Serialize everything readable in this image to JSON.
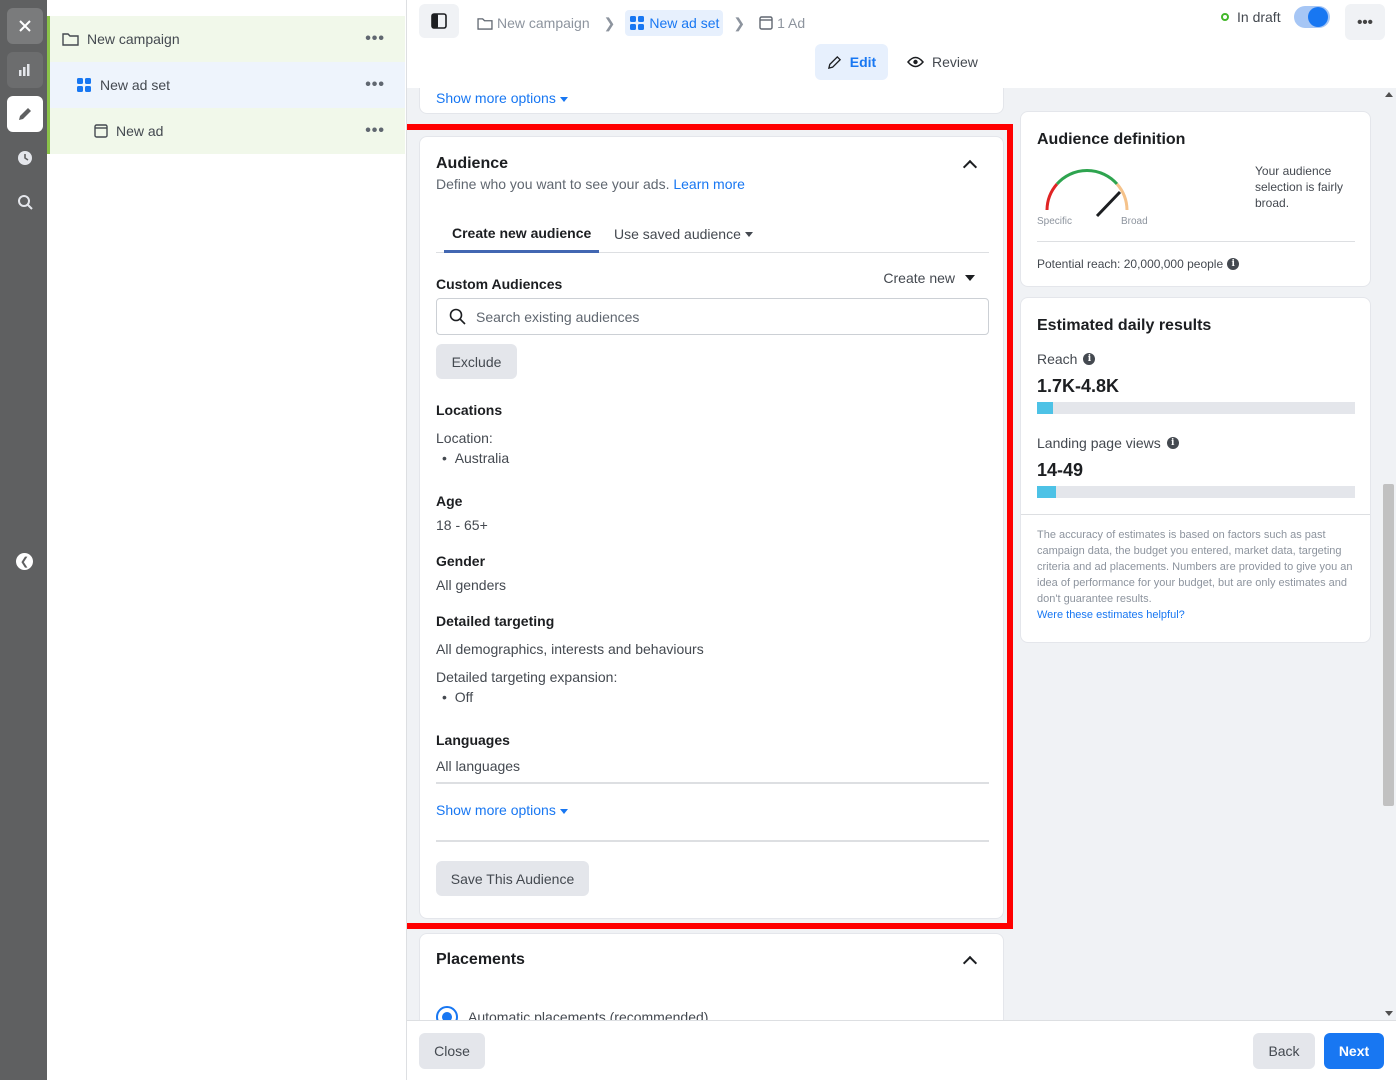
{
  "tree": {
    "campaign": "New campaign",
    "ad_set": "New ad set",
    "ad": "New ad",
    "more": "•••"
  },
  "header": {
    "breadcrumbs": [
      "New campaign",
      "New ad set",
      "1 Ad"
    ],
    "status": "In draft",
    "more": "•••",
    "edit_tab": "Edit",
    "review_tab": "Review"
  },
  "top_card": {
    "show_more": "Show more options"
  },
  "audience": {
    "title": "Audience",
    "subtitle": "Define who you want to see your ads.",
    "learn_more": "Learn more",
    "tab_create": "Create new audience",
    "tab_saved": "Use saved audience",
    "custom_label": "Custom Audiences",
    "create_new": "Create new",
    "search_placeholder": "Search existing audiences",
    "exclude": "Exclude",
    "locations_label": "Locations",
    "location_caption": "Location:",
    "location_value": "Australia",
    "age_label": "Age",
    "age_value": "18 - 65+",
    "gender_label": "Gender",
    "gender_value": "All genders",
    "targeting_label": "Detailed targeting",
    "targeting_value": "All demographics, interests and behaviours",
    "expansion_caption": "Detailed targeting expansion:",
    "expansion_value": "Off",
    "languages_label": "Languages",
    "languages_value": "All languages",
    "show_more": "Show more options",
    "save": "Save This Audience"
  },
  "placements": {
    "title": "Placements",
    "option": "Automatic placements (recommended)"
  },
  "definition": {
    "title": "Audience definition",
    "specific": "Specific",
    "broad": "Broad",
    "description": "Your audience selection is fairly broad.",
    "potential_reach": "Potential reach: 20,000,000 people"
  },
  "estimates": {
    "title": "Estimated daily results",
    "reach_label": "Reach",
    "reach_value": "1.7K-4.8K",
    "reach_fill": 0.05,
    "lpv_label": "Landing page views",
    "lpv_value": "14-49",
    "lpv_fill": 0.06,
    "note": "The accuracy of estimates is based on factors such as past campaign data, the budget you entered, market data, targeting criteria and ad placements. Numbers are provided to give you an idea of performance for your budget, but are only estimates and don't guarantee results.",
    "helpful": "Were these estimates helpful?"
  },
  "footer": {
    "close": "Close",
    "back": "Back",
    "next": "Next"
  },
  "colors": {
    "accent": "#1877f2",
    "highlight": "#ff0000",
    "draft": "#42b72a"
  }
}
